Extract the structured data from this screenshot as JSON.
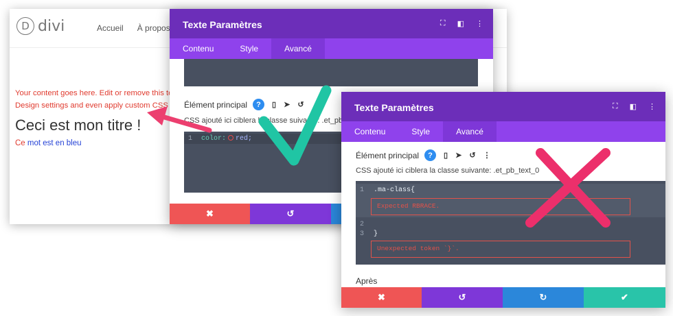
{
  "site": {
    "logo_letter": "D",
    "logo_text": "divi",
    "nav": [
      "Accueil",
      "À propos"
    ],
    "body_line1": "Your content goes here. Edit or remove this te",
    "body_line2": "Design settings and even apply custom CSS to",
    "heading": "Ceci est mon titre !",
    "blue_line_ce": "Ce",
    "blue_line_rest": " mot est en bleu"
  },
  "modal_back": {
    "title": "Texte Paramètres",
    "tabs": [
      "Contenu",
      "Style",
      "Avancé"
    ],
    "active_tab": "Avancé",
    "section_label": "Élément principal",
    "css_info": "CSS ajouté ici ciblera la classe suivante: .et_pb_te",
    "line_number": "1",
    "code_property": "color:",
    "code_value": "red;"
  },
  "modal_front": {
    "title": "Texte Paramètres",
    "tabs": [
      "Contenu",
      "Style",
      "Avancé"
    ],
    "active_tab": "Avancé",
    "section_label": "Élément principal",
    "css_info": "CSS ajouté ici ciblera la classe suivante: .et_pb_text_0",
    "line_numbers": [
      "1",
      "2",
      "3"
    ],
    "code_line1": ".ma-class{",
    "error1": "Expected RBRACE.",
    "code_line3": "}",
    "error2": "Unexpected token `}`.",
    "next_section": "Après"
  },
  "colors": {
    "header_purple": "#6c2eb9",
    "tab_purple": "#8f42ec",
    "cancel_red": "#ef5555",
    "undo_purple": "#7e37d8",
    "redo_blue": "#2b87da",
    "save_green": "#29c4a9",
    "check_teal": "#20c5a4",
    "cross_pink": "#ec2f6b",
    "arrow_pink": "#ec3f6f"
  },
  "icons": {
    "help": "?",
    "mobile": "mobile-icon",
    "hover": "cursor-icon",
    "reset": "undo-icon",
    "more": "more-icon",
    "cancel": "✖",
    "undo": "↺",
    "redo": "↻",
    "save": "✔"
  }
}
